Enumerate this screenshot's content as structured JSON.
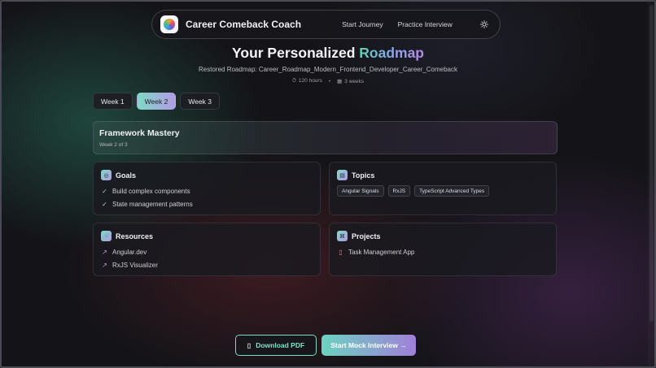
{
  "navbar": {
    "brand": "Career Comeback Coach",
    "links": [
      "Start Journey",
      "Practice Interview"
    ],
    "theme_icon": "sun-icon"
  },
  "header": {
    "title_prefix": "Your Personalized",
    "title_accent": "Roadmap",
    "subtitle": "Restored Roadmap: Career_Roadmap_Modern_Frontend_Developer_Career_Comeback",
    "hours": "120 hours",
    "weeks": "3 weeks"
  },
  "tabs": [
    "Week 1",
    "Week 2",
    "Week 3"
  ],
  "active_tab": "Week 2",
  "week": {
    "title": "Framework Mastery",
    "subtitle": "Week 2 of 3"
  },
  "goals": {
    "title": "Goals",
    "items": [
      "Build complex components",
      "State management patterns"
    ]
  },
  "topics": {
    "title": "Topics",
    "items": [
      "Angular Signals",
      "RxJS",
      "TypeScript Advanced Types"
    ]
  },
  "resources": {
    "title": "Resources",
    "items": [
      "Angular.dev",
      "RxJS Visualizer"
    ]
  },
  "projects": {
    "title": "Projects",
    "items": [
      "Task Management App"
    ]
  },
  "actions": {
    "download": "Download PDF",
    "mock": "Start Mock Interview →"
  },
  "colors": {
    "accent_start": "#7fd9c6",
    "accent_end": "#b39be6",
    "background": "#141418"
  }
}
